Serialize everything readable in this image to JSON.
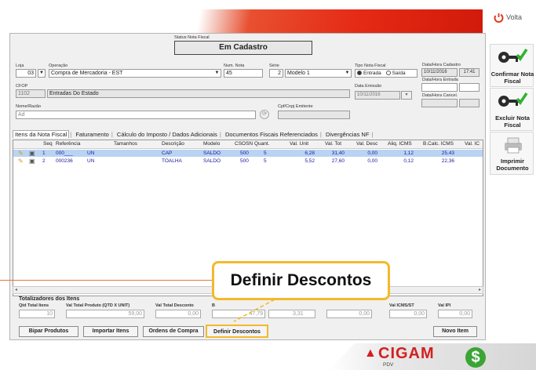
{
  "top_right": {
    "volta_label": "Volta"
  },
  "status": {
    "label": "Status Nota Fiscal",
    "value": "Em Cadastro"
  },
  "form": {
    "loja_label": "Loja",
    "loja_value": "03",
    "operacao_label": "Operação",
    "operacao_value": "Compra de Mercadoria - EST",
    "num_nota_label": "Num. Nota",
    "num_nota_value": "45",
    "serie_label": "Série",
    "serie_num": "2",
    "serie_value": "Modelo 1",
    "tipo_label": "Tipo Nota Fiscal",
    "tipo_entrada": "Entrada",
    "tipo_saida": "Saída",
    "cfop_label": "CFOP",
    "cfop_value": "1102",
    "cfop_desc": "Entradas Do Estado",
    "data_emissao_label": "Data Emissão",
    "data_emissao_value": "10/11/2016",
    "nome_label": "Nome/Razão",
    "nome_value": "Ad",
    "cpf_label": "Cpf/Cnpj Emitente",
    "cpf_value": "",
    "cadastro_label": "Data/Hora Cadastro",
    "cadastro_date": "10/11/2016",
    "cadastro_time": "17:41",
    "entrada_label": "Data/Hora Entrada",
    "cancel_label": "Data/Hora Cancel."
  },
  "tabs": [
    "Itens da Nota Fiscal",
    "Faturamento",
    "Cálculo do Imposto / Dados Adicionais",
    "Documentos Fiscais Referenciados",
    "Divergências NF"
  ],
  "grid": {
    "headers": [
      "Seq",
      "Referência",
      "Tamanhos",
      "Descrição",
      "Modelo",
      "CSOSN",
      "Quant.",
      "Val. Unit",
      "Val. Tot",
      "Val. Desc",
      "Aliq. ICMS",
      "B.Calc. ICMS",
      "Val. IC"
    ],
    "rows": [
      [
        "1",
        "000___",
        "UN",
        "CAP",
        "SALDO",
        "500",
        "5",
        "6,28",
        "31,40",
        "0,00",
        "1,12",
        "25,43"
      ],
      [
        "2",
        "000236",
        "UN",
        "TOALHA",
        "SALDO",
        "500",
        "5",
        "5,52",
        "27,60",
        "0,00",
        "0,12",
        "22,36"
      ]
    ]
  },
  "totals": {
    "title": "Totalizadores dos Itens",
    "qtd_label": "Qtd Total Itens",
    "qtd_value": "10",
    "prod_label": "Val Total Produto (QTD X UNIT)",
    "prod_value": "59,00",
    "desc_label": "Val Total Desconto",
    "desc_value": "0,00",
    "base_label": "B",
    "base_value": "47,79",
    "extra_value": "3,31",
    "mid_value": "0,00",
    "icms_st_label": "Val ICMS/ST",
    "icms_st_value": "0,00",
    "ipi_label": "Val IPI",
    "ipi_value": "0,00"
  },
  "buttons": {
    "bipar": "Bipar Produtos",
    "importar": "Importar Itens",
    "ordens": "Ordens de Compra",
    "definir": "Definir Descontos",
    "novo": "Novo Item"
  },
  "callout": {
    "text": "Definir Descontos"
  },
  "sidebar": {
    "confirmar": "Confirmar Nota Fiscal",
    "excluir": "Excluir Nota Fiscal",
    "imprimir": "Imprimir Documento"
  },
  "brand": {
    "name": "CIGAM",
    "sub": "PDV"
  },
  "colors": {
    "accent_red": "#e52a15",
    "callout_border": "#f3b92b",
    "row_selected": "#b9d4f3",
    "brand_green": "#3aa535"
  }
}
